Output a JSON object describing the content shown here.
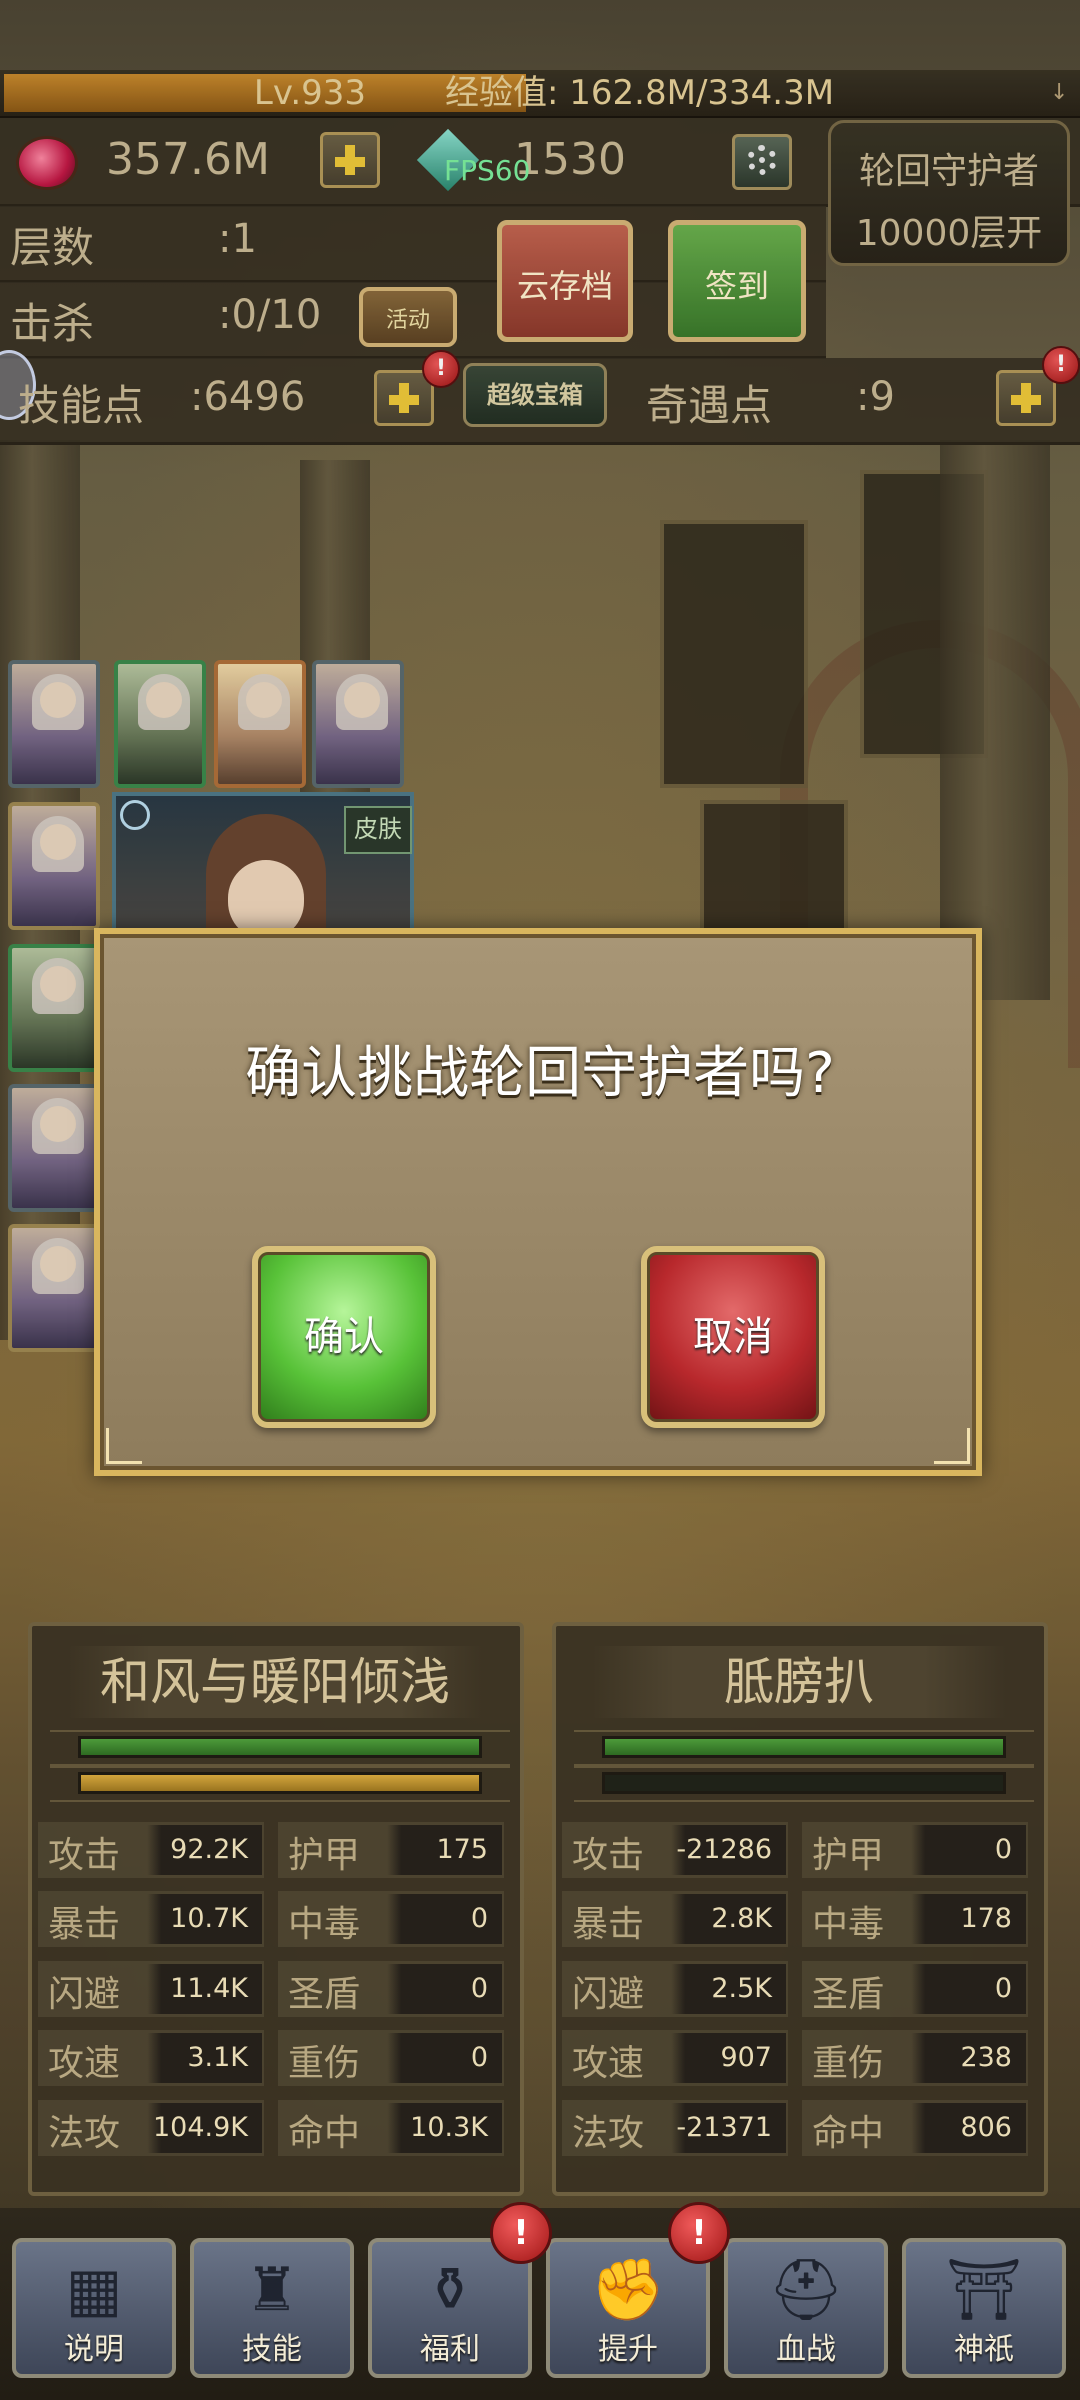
{
  "hud": {
    "level": "Lv.933",
    "exp_label": "经验值:",
    "exp_value": "162.8M/334.3M",
    "exp_progress": 0.487,
    "gems": "357.6M",
    "diamonds": "1530",
    "fps": "FPS60",
    "guardian_line1": "轮回守护者",
    "guardian_line2": "10000层开"
  },
  "stats_top": {
    "floor_label": "层数",
    "floor_value": ":1",
    "kills_label": "击杀",
    "kills_value": ":0/10",
    "skill_label": "技能点",
    "skill_value": ":6496",
    "encounter_label": "奇遇点",
    "encounter_value": ":9"
  },
  "buttons": {
    "event": "活动",
    "cloud_save": "云存档",
    "sign_in": "签到",
    "super_chest": "超级宝箱",
    "skin": "皮肤"
  },
  "dialog": {
    "message": "确认挑战轮回守护者吗?",
    "confirm": "确认",
    "cancel": "取消"
  },
  "player": {
    "name": "和风与暖阳倾浅",
    "hp_ratio": 1.0,
    "energy_ratio": 1.0,
    "stats": [
      {
        "label": "攻击",
        "value": "92.2K"
      },
      {
        "label": "护甲",
        "value": "175"
      },
      {
        "label": "暴击",
        "value": "10.7K"
      },
      {
        "label": "中毒",
        "value": "0"
      },
      {
        "label": "闪避",
        "value": "11.4K"
      },
      {
        "label": "圣盾",
        "value": "0"
      },
      {
        "label": "攻速",
        "value": "3.1K"
      },
      {
        "label": "重伤",
        "value": "0"
      },
      {
        "label": "法攻",
        "value": "104.9K"
      },
      {
        "label": "命中",
        "value": "10.3K"
      }
    ]
  },
  "enemy": {
    "name": "胝膀扒",
    "hp_ratio": 1.0,
    "energy_ratio": 0.0,
    "stats": [
      {
        "label": "攻击",
        "value": "-21286"
      },
      {
        "label": "护甲",
        "value": "0"
      },
      {
        "label": "暴击",
        "value": "2.8K"
      },
      {
        "label": "中毒",
        "value": "178"
      },
      {
        "label": "闪避",
        "value": "2.5K"
      },
      {
        "label": "圣盾",
        "value": "0"
      },
      {
        "label": "攻速",
        "value": "907"
      },
      {
        "label": "重伤",
        "value": "238"
      },
      {
        "label": "法攻",
        "value": "-21371"
      },
      {
        "label": "命中",
        "value": "806"
      }
    ]
  },
  "nav": [
    {
      "label": "说明",
      "icon": "grid-icon"
    },
    {
      "label": "技能",
      "icon": "hat-icon"
    },
    {
      "label": "福利",
      "icon": "money-bag-icon"
    },
    {
      "label": "提升",
      "icon": "handshake-icon"
    },
    {
      "label": "血战",
      "icon": "helmet-icon"
    },
    {
      "label": "神祇",
      "icon": "shrine-icon"
    }
  ],
  "alerts": {
    "mark": "!"
  }
}
